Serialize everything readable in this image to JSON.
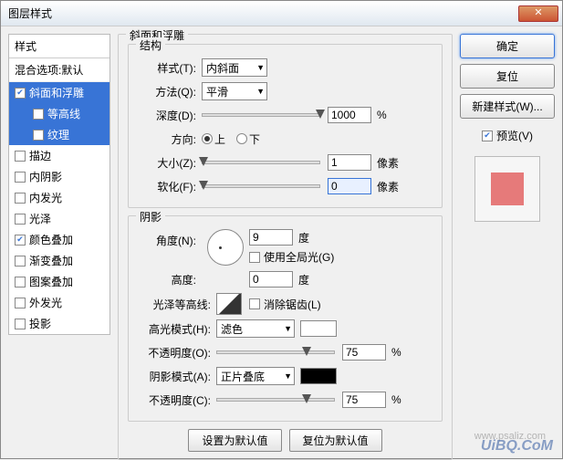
{
  "window": {
    "title": "图层样式"
  },
  "left": {
    "header": "样式",
    "blend": "混合选项:默认",
    "items": [
      {
        "label": "斜面和浮雕",
        "checked": true,
        "selected": true,
        "child": false
      },
      {
        "label": "等高线",
        "checked": false,
        "selected": true,
        "child": true
      },
      {
        "label": "纹理",
        "checked": false,
        "selected": true,
        "child": true
      },
      {
        "label": "描边",
        "checked": false,
        "selected": false,
        "child": false
      },
      {
        "label": "内阴影",
        "checked": false,
        "selected": false,
        "child": false
      },
      {
        "label": "内发光",
        "checked": false,
        "selected": false,
        "child": false
      },
      {
        "label": "光泽",
        "checked": false,
        "selected": false,
        "child": false
      },
      {
        "label": "颜色叠加",
        "checked": true,
        "selected": false,
        "child": false
      },
      {
        "label": "渐变叠加",
        "checked": false,
        "selected": false,
        "child": false
      },
      {
        "label": "图案叠加",
        "checked": false,
        "selected": false,
        "child": false
      },
      {
        "label": "外发光",
        "checked": false,
        "selected": false,
        "child": false
      },
      {
        "label": "投影",
        "checked": false,
        "selected": false,
        "child": false
      }
    ]
  },
  "center": {
    "title": "斜面和浮雕",
    "structure": {
      "legend": "结构",
      "style_label": "样式(T):",
      "style_value": "内斜面",
      "technique_label": "方法(Q):",
      "technique_value": "平滑",
      "depth_label": "深度(D):",
      "depth_value": "1000",
      "percent": "%",
      "direction_label": "方向:",
      "up": "上",
      "down": "下",
      "size_label": "大小(Z):",
      "size_value": "1",
      "px": "像素",
      "soften_label": "软化(F):",
      "soften_value": "0"
    },
    "shading": {
      "legend": "阴影",
      "angle_label": "角度(N):",
      "angle_value": "9",
      "deg": "度",
      "global_light": "使用全局光(G)",
      "altitude_label": "高度:",
      "altitude_value": "0",
      "gloss_contour_label": "光泽等高线:",
      "antialias": "消除锯齿(L)",
      "highlight_mode_label": "高光模式(H):",
      "highlight_mode_value": "滤色",
      "highlight_opacity_label": "不透明度(O):",
      "highlight_opacity_value": "75",
      "shadow_mode_label": "阴影模式(A):",
      "shadow_mode_value": "正片叠底",
      "shadow_opacity_label": "不透明度(C):",
      "shadow_opacity_value": "75"
    },
    "default_btn": "设置为默认值",
    "reset_btn": "复位为默认值"
  },
  "right": {
    "ok": "确定",
    "cancel": "复位",
    "new_style": "新建样式(W)...",
    "preview": "预览(V)"
  },
  "watermark": "UiBQ.CoM",
  "watermark2": "www.psaliz.com"
}
